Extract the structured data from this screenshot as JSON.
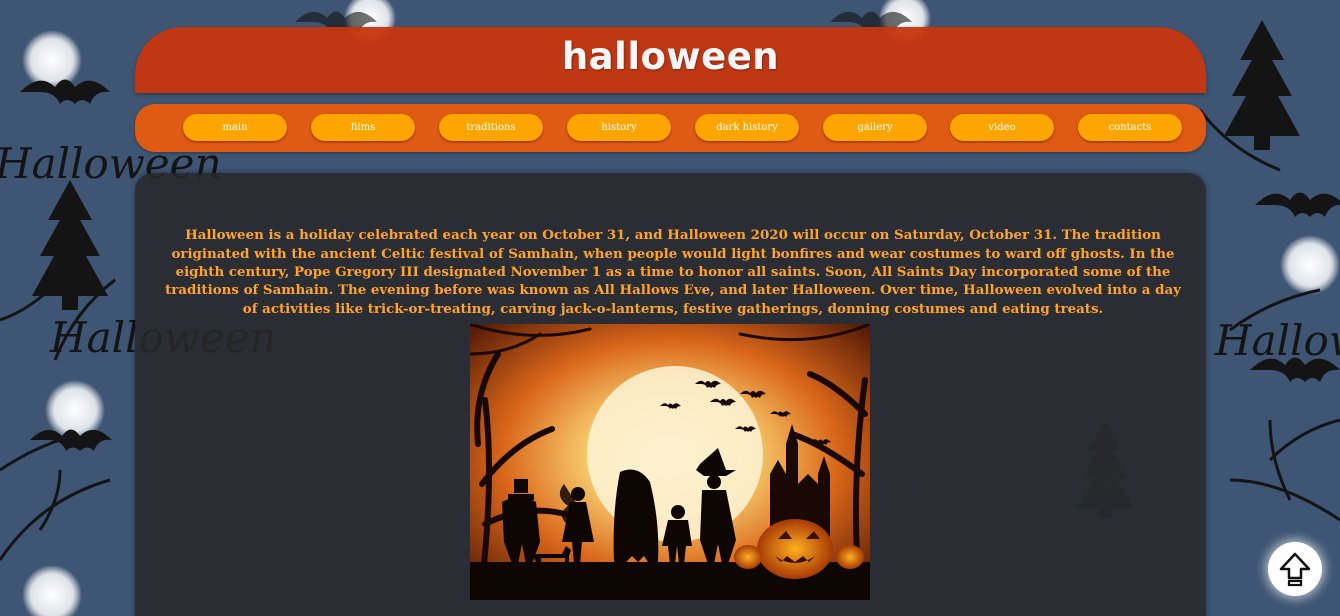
{
  "header": {
    "title": "halloween"
  },
  "nav": {
    "items": [
      {
        "label": "main"
      },
      {
        "label": "films"
      },
      {
        "label": "traditions"
      },
      {
        "label": "history"
      },
      {
        "label": "dark history"
      },
      {
        "label": "gallery"
      },
      {
        "label": "video"
      },
      {
        "label": "contacts"
      }
    ]
  },
  "content": {
    "intro": "Halloween is a holiday celebrated each year on October 31, and Halloween 2020 will occur on Saturday, October 31. The tradition originated with the ancient Celtic festival of Samhain, when people would light bonfires and wear costumes to ward off ghosts. In the eighth century, Pope Gregory III designated November 1 as a time to honor all saints. Soon, All Saints Day incorporated some of the traditions of Samhain. The evening before was known as All Hallows Eve, and later Halloween. Over time, Halloween evolved into a day of activities like trick-or-treating, carving jack-o-lanterns, festive gatherings, donning costumes and eating treats.",
    "image_icon": "halloween-scene-image"
  },
  "background": {
    "pattern_text": "Halloween"
  },
  "scroll_top": {
    "icon": "arrow-up-icon"
  },
  "colors": {
    "background": "#3e5573",
    "header": "#c8360e",
    "nav": "#df5a12",
    "nav_button": "#ffa500",
    "text_accent": "#ffa32a",
    "panel": "#28282a"
  }
}
